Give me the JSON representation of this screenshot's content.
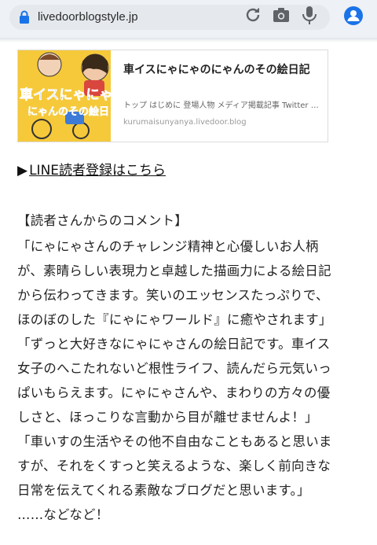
{
  "browser": {
    "url": "livedoorblogstyle.jp"
  },
  "card": {
    "thumb_text_1": "車イスにゃにゃ",
    "thumb_text_2": "にゃんのその絵日",
    "title": "車イスにゃにゃのにゃんのその絵日記",
    "description": "トップ はじめに 登場人物 メディア掲載記事 Twitter …",
    "url": "kurumaisunyanya.livedoor.blog"
  },
  "line_link": {
    "arrow": "▶",
    "label": "LINE読者登録はこちら"
  },
  "comments": {
    "heading": "【読者さんからのコメント】",
    "lines": [
      "「にゃにゃさんのチャレンジ精神と心優しいお人柄",
      "が、素晴らしい表現力と卓越した描画力による絵日記",
      "から伝わってきます。笑いのエッセンスたっぷりで、",
      "ほのぼのした『にゃにゃワールド』に癒やされます」",
      "「ずっと大好きなにゃにゃさんの絵日記です。車イス",
      "女子のへこたれないど根性ライフ、読んだら元気いっ",
      "ぱいもらえます。にゃにゃさんや、まわりの方々の優",
      "しさと、ほっこりな言動から目が離せませんよ！」",
      "「車いすの生活やその他不自由なこともあると思いま",
      "すが、それをくすっと笑えるような、楽しく前向きな",
      "日常を伝えてくれる素敵なブログだと思います。」",
      "……などなど！"
    ]
  },
  "colors": {
    "accent": "#1a73e8",
    "toolbar_bg": "#eef1f5",
    "thumb_bg": "#f6c93a"
  },
  "icons": [
    "lock-icon",
    "reload-icon",
    "camera-icon",
    "microphone-icon",
    "account-icon"
  ]
}
